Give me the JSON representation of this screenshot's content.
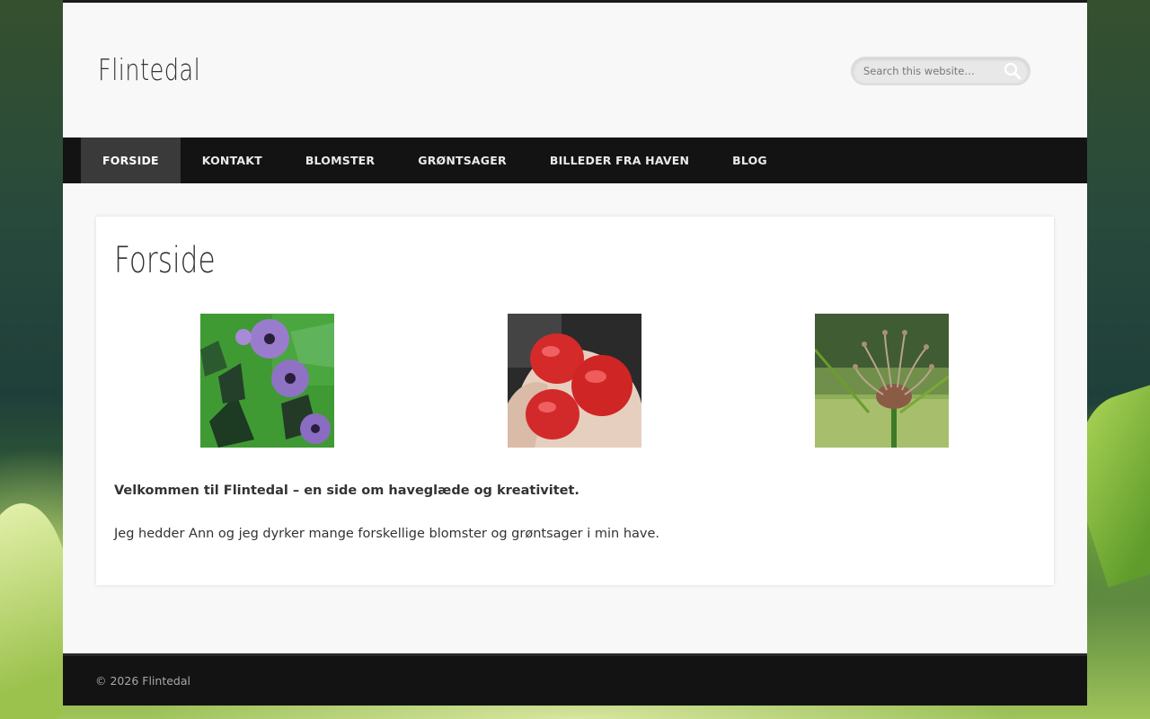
{
  "site": {
    "title": "Flintedal"
  },
  "search": {
    "placeholder": "Search this website…"
  },
  "nav": {
    "items": [
      {
        "label": "FORSIDE",
        "active": true
      },
      {
        "label": "KONTAKT",
        "active": false
      },
      {
        "label": "BLOMSTER",
        "active": false
      },
      {
        "label": "GRØNTSAGER",
        "active": false
      },
      {
        "label": "BILLEDER FRA HAVEN",
        "active": false
      },
      {
        "label": "BLOG",
        "active": false
      }
    ]
  },
  "main": {
    "title": "Forside",
    "intro_bold": "Velkommen til Flintedal – en side om haveglæde og kreativitet.",
    "intro_text": "Jeg hedder Ann og jeg dyrker mange forskellige blomster og grøntsager i min have."
  },
  "footer": {
    "copyright": "© 2026 Flintedal"
  },
  "colors": {
    "nav_bg": "#131313",
    "nav_active": "#3a3a3a",
    "page_bg": "#f8f8f8"
  }
}
